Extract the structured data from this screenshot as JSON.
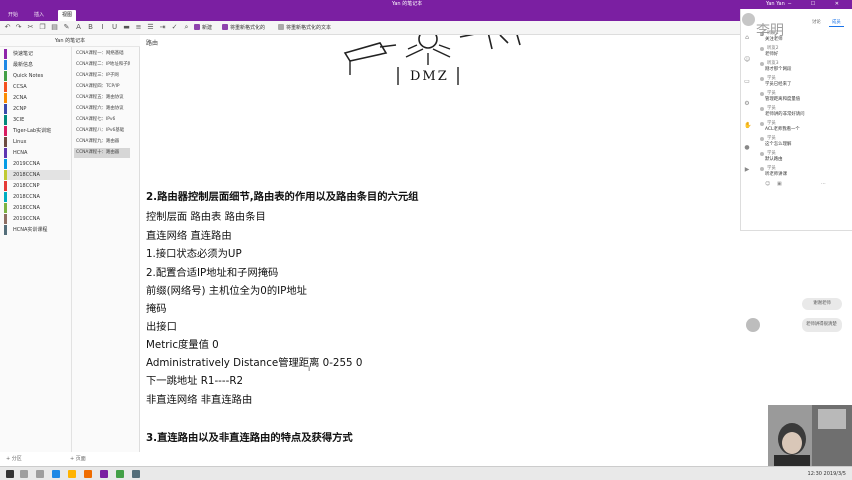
{
  "window": {
    "app_title": "Yan 的笔记本",
    "user": "Yan Yan",
    "controls": "─ ☐ ✕"
  },
  "ribbon": {
    "tabs": [
      "开始",
      "插入",
      "视图"
    ],
    "active_tab": 0,
    "toolbar_buttons": [
      "新建",
      "将重新格式化的",
      "将重新格式化的文本"
    ]
  },
  "notebook_title": "Yan 的笔记本",
  "sections": [
    "快速笔记",
    "最新信息",
    "Quick Notes",
    "CCSA",
    "2CNA",
    "2CNP",
    "3CIE",
    "Tiger-Lab实训班",
    "Linux",
    "HCNA",
    "2019CCNA",
    "2018CCNA",
    "2018CCNP",
    "2018CCNA",
    "2018CCNA",
    "2019CCNA",
    "HCNA实训课程"
  ],
  "active_section": 11,
  "pages": [
    "CCNA课程一：网络基础",
    "CCNA课程二：IP地址和子网",
    "CCNA课程三：IP子网",
    "CCNA课程四：TCP/IP",
    "CCNA课程五：路由协议",
    "CCNA课程六：路由协议",
    "CCNA课程七：IPv6",
    "CCNA课程八：IPv6基础",
    "CCNA课程九：路由器",
    "CCNA课程十：路由器"
  ],
  "active_page": 9,
  "pane_bottom": {
    "add_section": "+ 分区",
    "add_page": "+ 页面"
  },
  "canvas": {
    "top_label": "路由",
    "dmz_label": "DMZ",
    "heading2": "2.路由器控制层面细节,路由表的作用以及路由条目的六元组",
    "lines": [
      "控制层面  路由表  路由条目",
      "直连网络      直连路由",
      "1.接口状态必须为UP",
      "2.配置合适IP地址和子网掩码",
      "前缀(网络号) 主机位全为0的IP地址",
      "掩码",
      "出接口",
      "Metric度量值 0",
      "Administratively Distance管理距离 0-255 0",
      "下一跳地址         R1----R2",
      "非直连网络  非直连路由"
    ],
    "heading3": "3.直连路由以及非直连路由的特点及获得方式"
  },
  "chat": {
    "tabs": [
      "讨论",
      "成员"
    ],
    "handwriting": "李明",
    "messages": [
      {
        "name": "听友1",
        "text": "关注老师"
      },
      {
        "name": "听友2",
        "text": "老师好"
      },
      {
        "name": "听友3",
        "text": "刚才那个网段"
      },
      {
        "name": "学员",
        "text": "学员已经来了"
      },
      {
        "name": "学员",
        "text": "管理距离和度量值"
      },
      {
        "name": "学员",
        "text": "老师讲的非常好请问"
      },
      {
        "name": "学员",
        "text": "ACL老师我看一个"
      },
      {
        "name": "学员",
        "text": "这个怎么理解"
      },
      {
        "name": "学员",
        "text": "默认路由"
      },
      {
        "name": "学员",
        "text": "听老师讲课"
      }
    ]
  },
  "bubbles": [
    "谢谢老师",
    "老师讲得很清楚"
  ],
  "taskbar": {
    "clock": "12:30",
    "date": "2019/3/5"
  },
  "colors": {
    "accent": "#7b1fa2",
    "task_onenote": "#7b1fa2",
    "task_blue": "#1e88e5",
    "task_orange": "#ef6c00"
  }
}
